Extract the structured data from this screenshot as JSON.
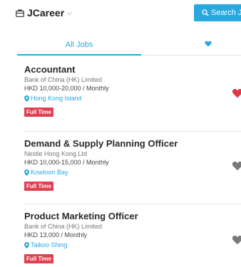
{
  "header": {
    "brand": "JCareer",
    "search_label": "Search Jobs"
  },
  "tabs": {
    "all_jobs": "All Jobs"
  },
  "jobs": [
    {
      "title": "Accountant",
      "company": "Bank of China (HK) Limited",
      "salary": "HKD 10,000-20,000 / Monthly",
      "location": "Hong Kong Island",
      "type": "Full Time",
      "favorited": true
    },
    {
      "title": "Demand & Supply Planning Officer",
      "company": "Nestle Hong Kong Ltd",
      "salary": "HKD 10,000-15,000 / Monthly",
      "location": "Kowloon Bay",
      "type": "Full Time",
      "favorited": false
    },
    {
      "title": "Product Marketing Officer",
      "company": "Bank of China (HK) Limited",
      "salary": "HKD 13,000 / Monthly",
      "location": "Taikoo Shing",
      "type": "Full Time",
      "favorited": false
    }
  ],
  "colors": {
    "accent": "#29a8e0",
    "badge": "#e04050",
    "heart_active": "#e0364a",
    "heart_inactive": "#7a7a7a"
  }
}
